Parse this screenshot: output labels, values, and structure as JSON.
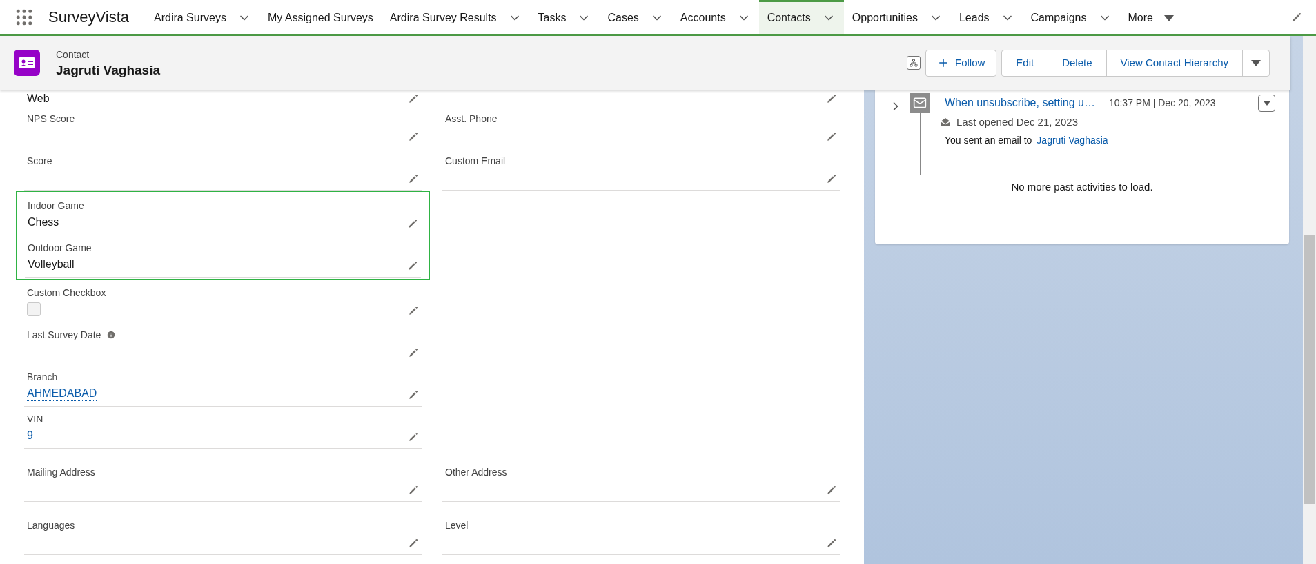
{
  "app": {
    "name": "SurveyVista"
  },
  "nav": [
    {
      "kind": "tab",
      "label": "Ardira Surveys",
      "has_menu": true,
      "selected": false
    },
    {
      "kind": "tab",
      "label": "My Assigned Surveys",
      "has_menu": false,
      "selected": false
    },
    {
      "kind": "tab",
      "label": "Ardira Survey Results",
      "has_menu": true,
      "selected": false
    },
    {
      "kind": "tab",
      "label": "Tasks",
      "has_menu": true,
      "selected": false
    },
    {
      "kind": "tab",
      "label": "Cases",
      "has_menu": true,
      "selected": false
    },
    {
      "kind": "tab",
      "label": "Accounts",
      "has_menu": true,
      "selected": false
    },
    {
      "kind": "tab",
      "label": "Contacts",
      "has_menu": true,
      "selected": true
    },
    {
      "kind": "tab",
      "label": "Opportunities",
      "has_menu": true,
      "selected": false
    },
    {
      "kind": "tab",
      "label": "Leads",
      "has_menu": true,
      "selected": false
    },
    {
      "kind": "tab",
      "label": "Campaigns",
      "has_menu": true,
      "selected": false
    },
    {
      "kind": "more",
      "label": "More",
      "has_menu": true,
      "selected": false
    }
  ],
  "record": {
    "object": "Contact",
    "name": "Jagruti Vaghasia"
  },
  "actions": {
    "follow": "Follow",
    "group": [
      "Edit",
      "Delete",
      "View Contact Hierarchy"
    ]
  },
  "details": {
    "left": [
      {
        "kind": "field",
        "value": {
          "kind": "text",
          "text": "Web"
        }
      },
      {
        "kind": "field",
        "label": "NPS Score"
      },
      {
        "kind": "field",
        "label": "Score"
      },
      {
        "kind": "highlight",
        "fields": [
          {
            "kind": "field",
            "label": "Indoor Game",
            "value": {
              "kind": "text",
              "text": "Chess"
            }
          },
          {
            "kind": "field",
            "label": "Outdoor Game",
            "value": {
              "kind": "text",
              "text": "Volleyball"
            }
          }
        ]
      },
      {
        "kind": "field",
        "label": "Custom Checkbox",
        "value": {
          "kind": "checkbox",
          "checked": false
        }
      },
      {
        "kind": "field",
        "label": "Last Survey Date",
        "info": true
      },
      {
        "kind": "field",
        "label": "Branch",
        "value": {
          "kind": "link",
          "text": "AHMEDABAD"
        }
      },
      {
        "kind": "field",
        "label": "VIN",
        "value": {
          "kind": "link",
          "text": "9"
        }
      }
    ],
    "right": [
      {
        "kind": "field"
      },
      {
        "kind": "field",
        "label": "Asst. Phone"
      },
      {
        "kind": "field",
        "label": "Custom Email"
      }
    ],
    "pairs": [
      {
        "left": {
          "label": "Mailing Address"
        },
        "right": {
          "label": "Other Address"
        }
      },
      {
        "left": {
          "label": "Languages"
        },
        "right": {
          "label": "Level"
        }
      }
    ]
  },
  "activity": {
    "subject": "When unsubscribe, setting u…",
    "time": "10:37 PM | Dec 20, 2023",
    "opened": "Last opened Dec 21, 2023",
    "sent_text": "You sent an email to",
    "recipient": "Jagruti Vaghasia",
    "footer": "No more past activities to load."
  }
}
